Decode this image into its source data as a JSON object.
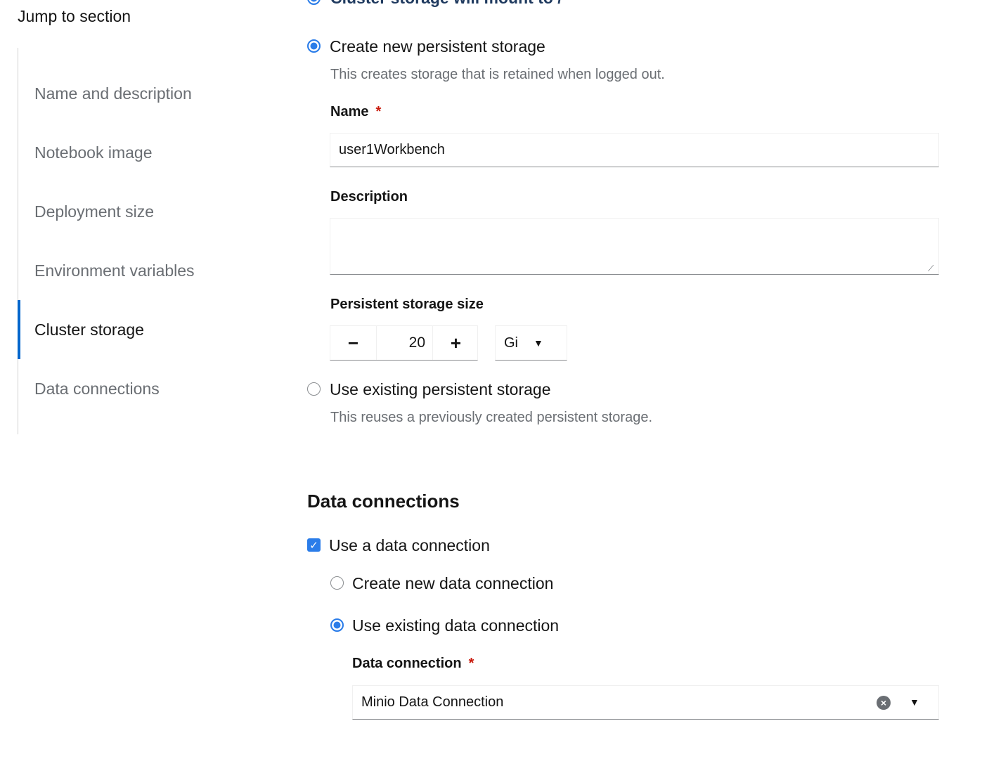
{
  "nav": {
    "title": "Jump to section",
    "items": [
      {
        "label": "Name and description"
      },
      {
        "label": "Notebook image"
      },
      {
        "label": "Deployment size"
      },
      {
        "label": "Environment variables"
      },
      {
        "label": "Cluster storage",
        "active": true
      },
      {
        "label": "Data connections"
      }
    ]
  },
  "storage": {
    "cut_heading": "Cluster storage will mount to /",
    "create_new": {
      "label": "Create new persistent storage",
      "help": "This creates storage that is retained when logged out.",
      "selected": true
    },
    "name_label": "Name",
    "required_mark": "*",
    "name_value": "user1Workbench",
    "description_label": "Description",
    "description_value": "",
    "size_label": "Persistent storage size",
    "size_value": "20",
    "minus": "−",
    "plus": "+",
    "unit": "Gi",
    "use_existing": {
      "label": "Use existing persistent storage",
      "help": "This reuses a previously created persistent storage.",
      "selected": false
    }
  },
  "data_connections": {
    "heading": "Data connections",
    "use_checkbox": {
      "label": "Use a data connection",
      "checked": true
    },
    "create_new": {
      "label": "Create new data connection",
      "selected": false
    },
    "use_existing": {
      "label": "Use existing data connection",
      "selected": true
    },
    "field_label": "Data connection",
    "required_mark": "*",
    "value": "Minio Data Connection"
  }
}
